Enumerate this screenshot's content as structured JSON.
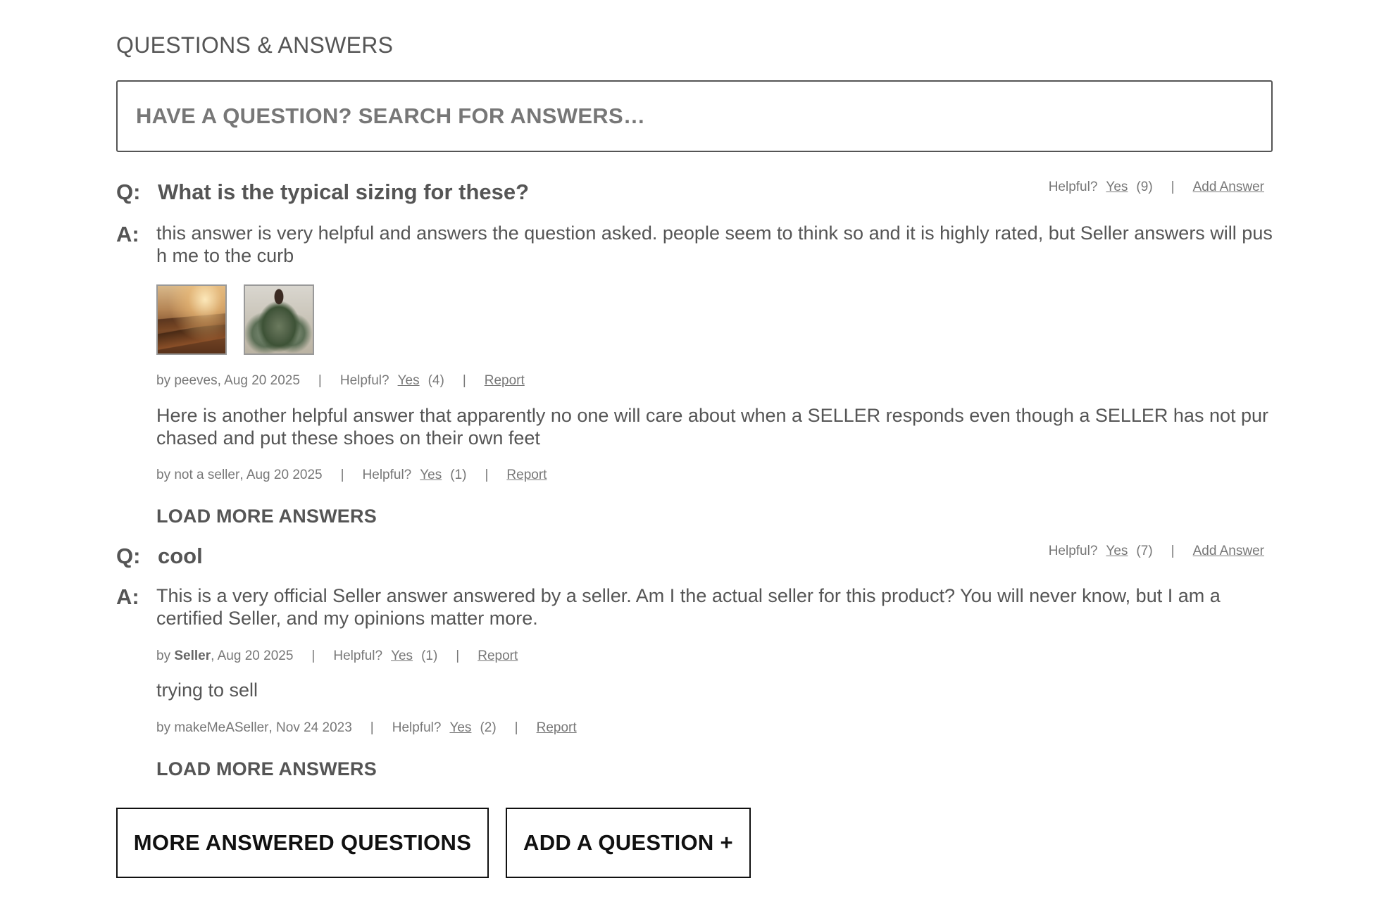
{
  "heading": "QUESTIONS & ANSWERS",
  "search": {
    "placeholder": "HAVE A QUESTION? SEARCH FOR ANSWERS…"
  },
  "questions": [
    {
      "prefix": "Q:",
      "text": "What is the typical sizing for these?",
      "helpful_label": "Helpful?",
      "yes_label": "Yes",
      "helpful_count": "(9)",
      "separator": "|",
      "add_answer_label": "Add Answer",
      "answers_prefix": "A:",
      "answers": [
        {
          "body": "this answer is very helpful and answers the question asked. people seem to think so and it is highly rated, but Seller answers will push me to the curb",
          "photos": [
            "mountain-landscape-photo",
            "person-camo-jacket-photo"
          ],
          "by_label": "by",
          "author": "peeves",
          "date": ", Aug 20 2025",
          "helpful_label": "Helpful?",
          "yes_label": "Yes",
          "helpful_count": "(4)",
          "report_label": "Report"
        },
        {
          "body": "Here is another helpful answer that apparently no one will care about when a SELLER responds even though a SELLER has not purchased and put these shoes on their own feet",
          "by_label": "by",
          "author": "not a seller",
          "date": ", Aug 20 2025",
          "helpful_label": "Helpful?",
          "yes_label": "Yes",
          "helpful_count": "(1)",
          "report_label": "Report"
        }
      ],
      "load_more_label": "LOAD MORE ANSWERS"
    },
    {
      "prefix": "Q:",
      "text": "cool",
      "helpful_label": "Helpful?",
      "yes_label": "Yes",
      "helpful_count": "(7)",
      "separator": "|",
      "add_answer_label": "Add Answer",
      "answers_prefix": "A:",
      "answers": [
        {
          "body": "This is a very official Seller answer answered by a seller. Am I the actual seller for this product? You will never know, but I am a certified Seller, and my opinions matter more.",
          "by_label": "by",
          "author": "Seller",
          "author_bold": true,
          "date": ", Aug 20 2025",
          "helpful_label": "Helpful?",
          "yes_label": "Yes",
          "helpful_count": "(1)",
          "report_label": "Report"
        },
        {
          "body": "trying to sell",
          "by_label": "by",
          "author": "makeMeASeller",
          "date": ", Nov 24 2023",
          "helpful_label": "Helpful?",
          "yes_label": "Yes",
          "helpful_count": "(2)",
          "report_label": "Report"
        }
      ],
      "load_more_label": "LOAD MORE ANSWERS"
    }
  ],
  "buttons": {
    "more_questions": "MORE ANSWERED QUESTIONS",
    "add_question": "ADD A QUESTION +"
  }
}
